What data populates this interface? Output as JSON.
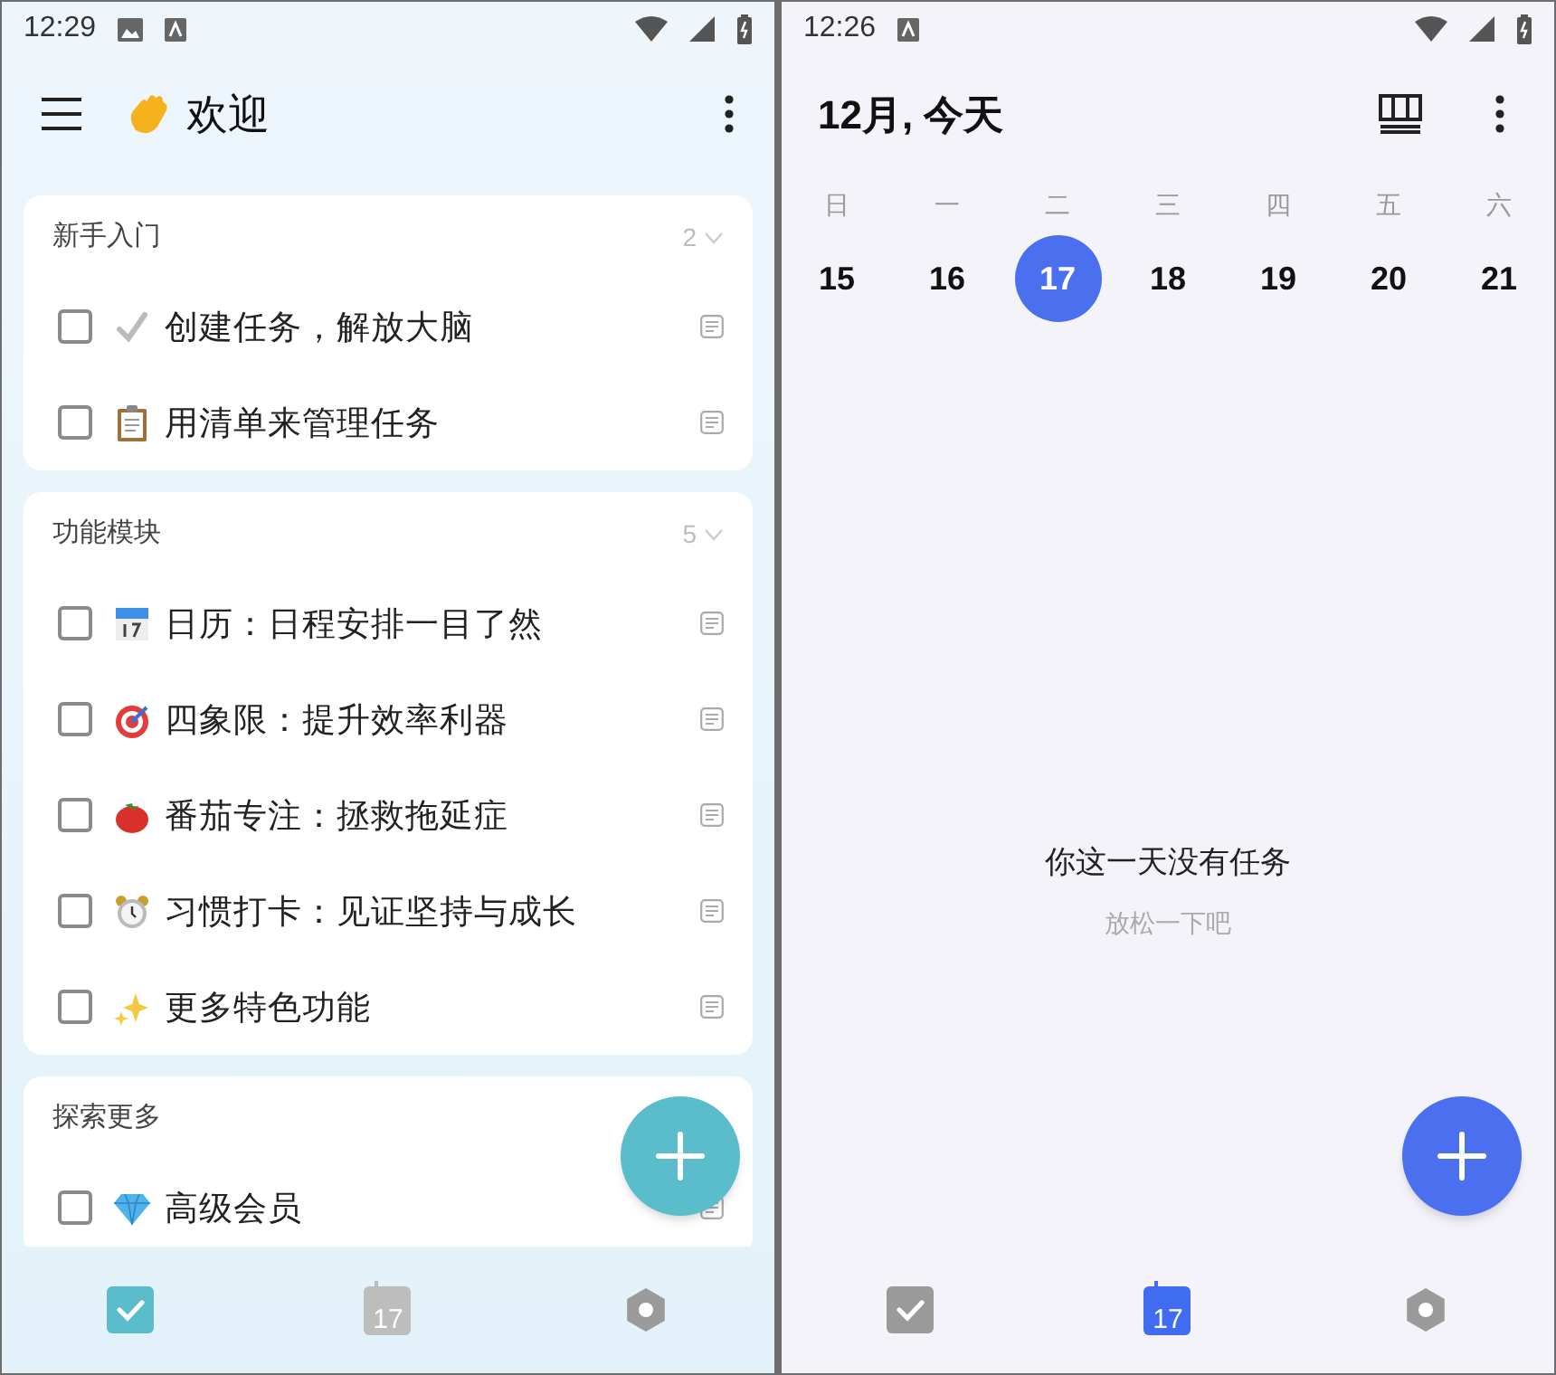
{
  "task_list_screen": {
    "status_bar": {
      "time": "12:29"
    },
    "app_bar": {
      "title": "欢迎"
    },
    "sections": [
      {
        "title": "新手入门",
        "count": "2",
        "items": [
          {
            "label": "创建任务，解放大脑",
            "checked": false
          },
          {
            "label": "用清单来管理任务",
            "checked": false
          }
        ]
      },
      {
        "title": "功能模块",
        "count": "5",
        "items": [
          {
            "label": "日历：日程安排一目了然",
            "checked": false
          },
          {
            "label": "四象限：提升效率利器",
            "checked": false
          },
          {
            "label": "番茄专注：拯救拖延症",
            "checked": false
          },
          {
            "label": "习惯打卡：见证坚持与成长",
            "checked": false
          },
          {
            "label": "更多特色功能",
            "checked": false
          }
        ]
      },
      {
        "title": "探索更多",
        "items": [
          {
            "label": "高级会员",
            "checked": false
          }
        ]
      }
    ],
    "nav": [
      {
        "kind": "tasks",
        "selected": true
      },
      {
        "kind": "calendar",
        "text": "17",
        "selected": false
      },
      {
        "kind": "settings",
        "selected": false
      }
    ]
  },
  "calendar_screen": {
    "status_bar": {
      "time": "12:26"
    },
    "app_bar": {
      "title": "12月, 今天"
    },
    "week": [
      {
        "weekday": "日",
        "date": "15",
        "selected": false
      },
      {
        "weekday": "一",
        "date": "16",
        "selected": false
      },
      {
        "weekday": "二",
        "date": "17",
        "selected": true
      },
      {
        "weekday": "三",
        "date": "18",
        "selected": false
      },
      {
        "weekday": "四",
        "date": "19",
        "selected": false
      },
      {
        "weekday": "五",
        "date": "20",
        "selected": false
      },
      {
        "weekday": "六",
        "date": "21",
        "selected": false
      }
    ],
    "empty_state": {
      "title": "你这一天没有任务",
      "subtitle": "放松一下吧"
    },
    "nav": [
      {
        "kind": "tasks",
        "selected": false
      },
      {
        "kind": "calendar",
        "text": "17",
        "selected": true
      },
      {
        "kind": "settings",
        "selected": false
      }
    ]
  }
}
